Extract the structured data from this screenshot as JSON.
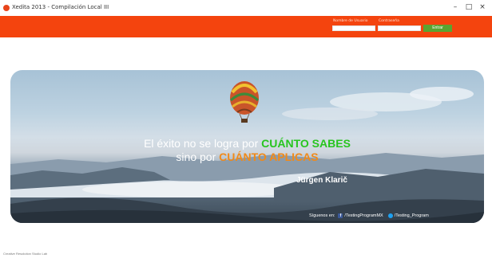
{
  "window": {
    "title": "Xedita 2013 - Compilación Local III",
    "minimize_glyph": "–",
    "maximize_glyph": "□",
    "close_glyph": "×"
  },
  "login": {
    "user_label": "Nombre de Usuario",
    "user_value": "",
    "password_label": "Contraseña",
    "password_value": "",
    "submit_label": "Entrar"
  },
  "banner": {
    "quote_line1_prefix": "El éxito no se logra por ",
    "quote_line1_highlight": "CUÁNTO SABES",
    "quote_line2_prefix": "sino por ",
    "quote_line2_highlight": "CUÁNTO APLICAS",
    "author": "Jürgen Klarič",
    "social_prompt": "Síguenos en:",
    "facebook_handle": "/TestingProgramMX",
    "twitter_handle": "/Testing_Program"
  },
  "status": {
    "text": "Creative Resolution Studio Lab"
  },
  "colors": {
    "accent": "#f4440e",
    "button": "#5aa431",
    "quote_green": "#27c51e",
    "quote_orange": "#f08a1a"
  },
  "icons": [
    "app-icon",
    "minimize-icon",
    "maximize-icon",
    "close-icon",
    "hot-air-balloon-icon",
    "facebook-icon",
    "twitter-icon"
  ]
}
